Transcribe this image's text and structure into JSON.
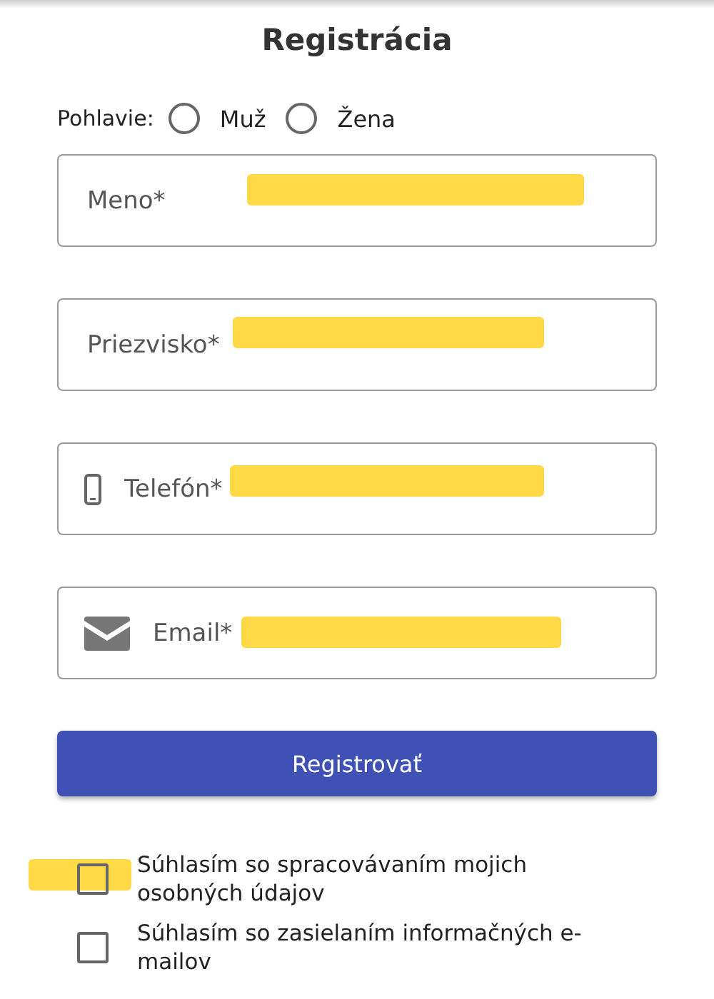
{
  "title": "Registrácia",
  "gender": {
    "label": "Pohlavie:",
    "options": [
      {
        "label": "Muž",
        "selected": false
      },
      {
        "label": "Žena",
        "selected": false
      }
    ]
  },
  "fields": [
    {
      "kind": "plain",
      "placeholder": "Meno*",
      "highlighted": true
    },
    {
      "kind": "plain",
      "placeholder": "Priezvisko*",
      "highlighted": true
    },
    {
      "kind": "phone",
      "placeholder": "Telefón*",
      "highlighted": true
    },
    {
      "kind": "email",
      "placeholder": "Email*",
      "highlighted": true
    }
  ],
  "submit": "Registrovať",
  "consents": [
    {
      "label": "Súhlasím so spracovávaním mojich osobných údajov",
      "checked": false,
      "highlighted": true
    },
    {
      "label": "Súhlasím so zasielaním informačných e-mailov",
      "checked": false
    }
  ]
}
